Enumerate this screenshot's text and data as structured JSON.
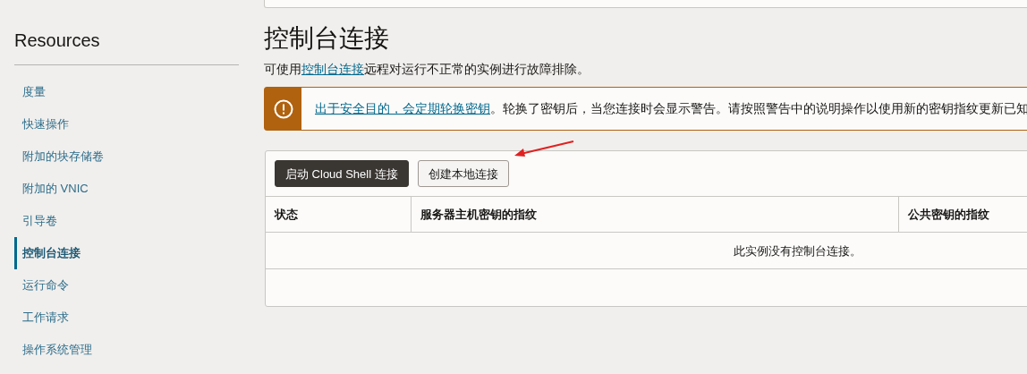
{
  "sidebar": {
    "title": "Resources",
    "items": [
      {
        "label": "度量",
        "selected": false
      },
      {
        "label": "快速操作",
        "selected": false
      },
      {
        "label": "附加的块存储卷",
        "selected": false
      },
      {
        "label": "附加的 VNIC",
        "selected": false
      },
      {
        "label": "引导卷",
        "selected": false
      },
      {
        "label": "控制台连接",
        "selected": true
      },
      {
        "label": "运行命令",
        "selected": false
      },
      {
        "label": "工作请求",
        "selected": false
      },
      {
        "label": "操作系统管理",
        "selected": false
      }
    ]
  },
  "page": {
    "title": "控制台连接",
    "description": {
      "before": "可使用",
      "link": "控制台连接",
      "after": "远程对运行不正常的实例进行故障排除。"
    }
  },
  "alert": {
    "link": "出于安全目的，会定期轮换密钥",
    "text": "。轮换了密钥后，当您连接时会显示警告。请按照警告中的说明操作以使用新的密钥指纹更新已知"
  },
  "buttons": [
    {
      "label": "启动 Cloud Shell 连接",
      "kind": "primary"
    },
    {
      "label": "创建本地连接",
      "kind": "secondary"
    }
  ],
  "table": {
    "columns": [
      "状态",
      "服务器主机密钥的指纹",
      "公共密钥的指纹"
    ],
    "empty_message": "此实例没有控制台连接。"
  }
}
